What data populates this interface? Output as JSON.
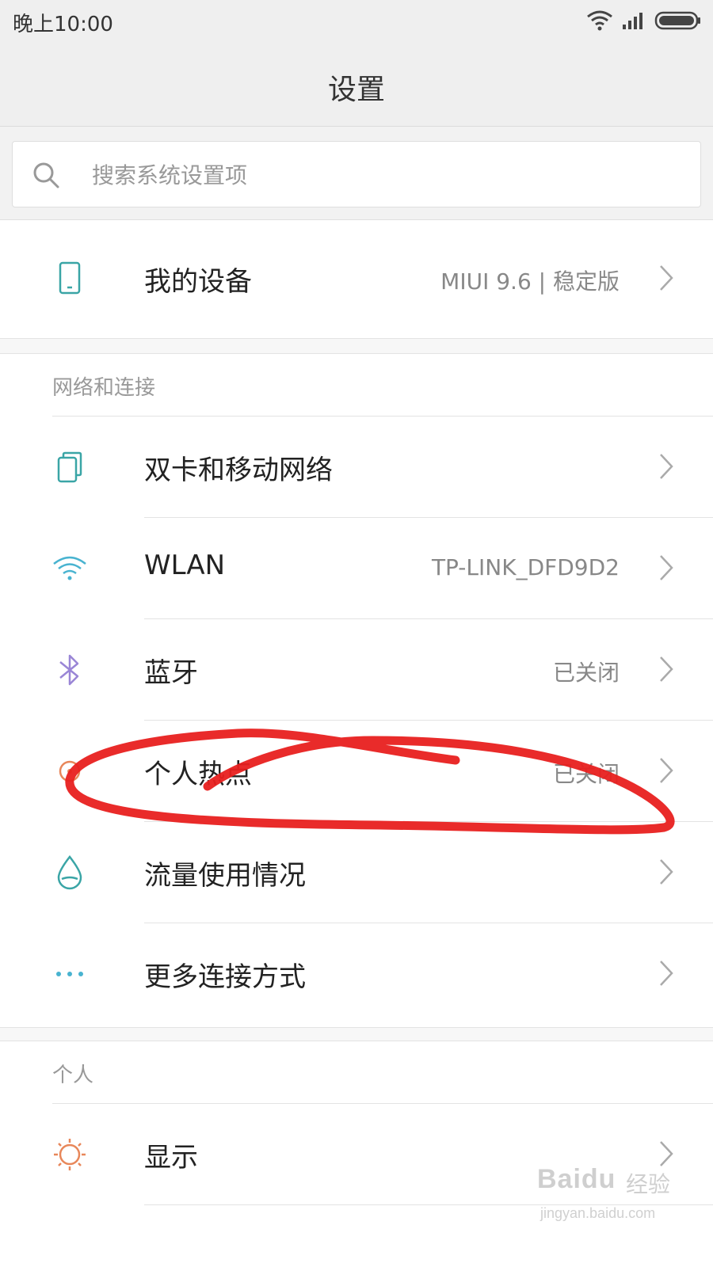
{
  "status_bar": {
    "time": "晚上10:00"
  },
  "title_bar": {
    "title": "设置"
  },
  "search": {
    "placeholder": "搜索系统设置项"
  },
  "device": {
    "label": "我的设备",
    "value": "MIUI 9.6 | 稳定版"
  },
  "sections": [
    {
      "header": "网络和连接",
      "items": [
        {
          "label": "双卡和移动网络",
          "value": "",
          "icon": "sim-card-icon"
        },
        {
          "label": "WLAN",
          "value": "TP-LINK_DFD9D2",
          "icon": "wifi-icon"
        },
        {
          "label": "蓝牙",
          "value": "已关闭",
          "icon": "bluetooth-icon"
        },
        {
          "label": "个人热点",
          "value": "已关闭",
          "icon": "hotspot-icon"
        },
        {
          "label": "流量使用情况",
          "value": "",
          "icon": "data-usage-icon"
        },
        {
          "label": "更多连接方式",
          "value": "",
          "icon": "more-dots-icon"
        }
      ]
    },
    {
      "header": "个人",
      "items": [
        {
          "label": "显示",
          "value": "",
          "icon": "display-brightness-icon"
        }
      ]
    }
  ],
  "watermark": {
    "logo": "Baidu",
    "suffix": "经验",
    "url": "jingyan.baidu.com"
  },
  "colors": {
    "accent_teal": "#3aa5a6",
    "wifi_blue": "#48b3d0",
    "bluetooth_purple": "#9a86d6",
    "hotspot_orange": "#e8875a",
    "annotation_red": "#e8201f"
  }
}
